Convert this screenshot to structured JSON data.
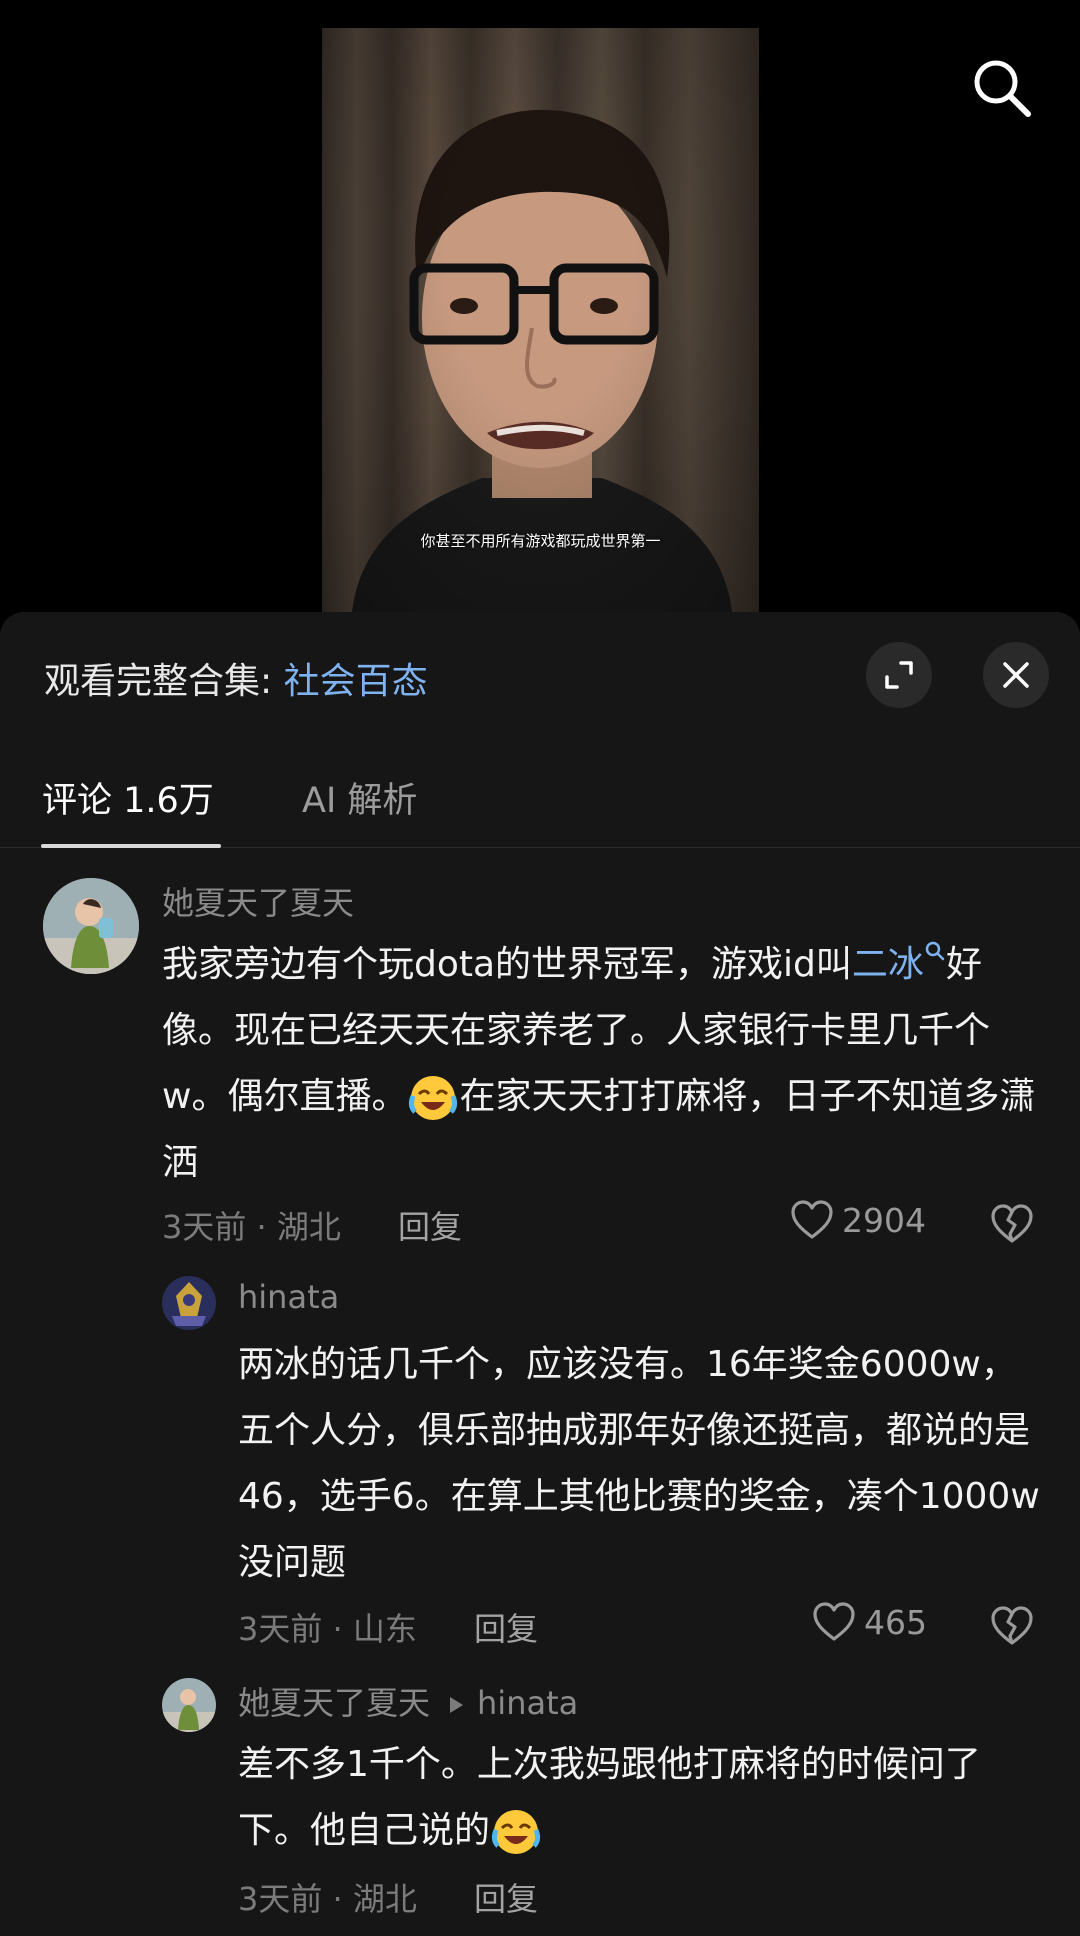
{
  "video": {
    "subtitle": "你甚至不用所有游戏都玩成世界第一"
  },
  "header": {
    "collection_label": "观看完整合集: ",
    "collection_name": "社会百态"
  },
  "tabs": [
    {
      "label": "评论 1.6万",
      "active": true
    },
    {
      "label": "AI 解析",
      "active": false
    }
  ],
  "comments": [
    {
      "user": "她夏天了夏天",
      "text_part1": "我家旁边有个玩dota的世界冠军，游戏id叫",
      "link_word": "二冰",
      "text_part2": "好像。现在已经天天在家养老了。人家银行卡里几千个w。偶尔直播。",
      "text_part3": "在家天天打打麻将，日子不知道多潇洒",
      "meta": "3天前 · 湖北",
      "reply_label": "回复",
      "likes": "2904"
    },
    {
      "user": "hinata",
      "text": "两冰的话几千个，应该没有。16年奖金6000w，五个人分，俱乐部抽成那年好像还挺高，都说的是46，选手6。在算上其他比赛的奖金，凑个1000w没问题",
      "meta": "3天前 · 山东",
      "reply_label": "回复",
      "likes": "465"
    },
    {
      "user": "她夏天了夏天",
      "reply_to": "hinata",
      "text": "差不多1千个。上次我妈跟他打麻将的时候问了下。他自己说的",
      "meta": "3天前 · 湖北",
      "reply_label": "回复"
    }
  ],
  "colors": {
    "link": "#7fb3f0",
    "sheet_bg": "#161616"
  },
  "icons": [
    "search-icon",
    "expand-icon",
    "close-icon",
    "heart-icon",
    "broken-heart-icon",
    "search-small-icon",
    "laughing-crying-emoji"
  ]
}
